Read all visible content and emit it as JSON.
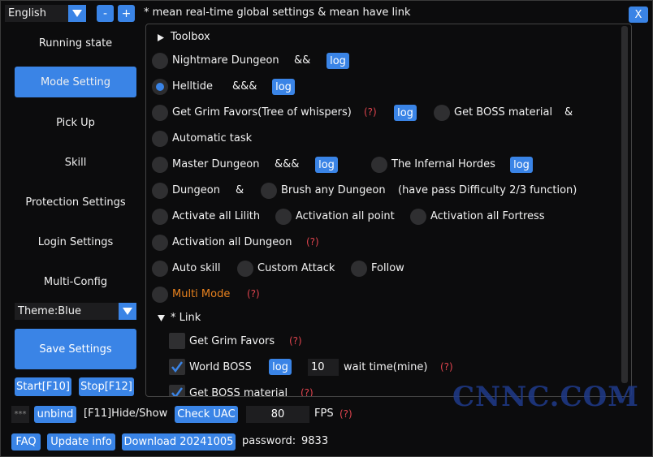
{
  "topbar": {
    "language": "English",
    "minus": "-",
    "plus": "+",
    "legend": "* mean real-time global settings   & mean have link",
    "close": "X"
  },
  "sidebar": {
    "items": [
      {
        "label": "Running state"
      },
      {
        "label": "Mode Setting"
      },
      {
        "label": "Pick Up"
      },
      {
        "label": "Skill"
      },
      {
        "label": "Protection Settings"
      },
      {
        "label": "Login Settings"
      },
      {
        "label": "Multi-Config"
      }
    ],
    "theme": "Theme:Blue",
    "save": "Save Settings",
    "start": "Start[F10]",
    "stop": "Stop[F12]"
  },
  "panel": {
    "toolbox": "Toolbox",
    "log": "log",
    "q": "(?)",
    "rows": {
      "nightmare": "Nightmare Dungeon",
      "nightmare_amp": "&&",
      "helltide": "Helltide",
      "helltide_amp": "&&&",
      "grim": "Get Grim Favors(Tree of whispers)",
      "boss_mat": "Get BOSS material",
      "boss_amp": "&",
      "auto_task": "Automatic task",
      "master": "Master Dungeon",
      "master_amp": "&&&",
      "hordes": "The Infernal Hordes",
      "dungeon": "Dungeon",
      "dungeon_amp": "&",
      "brush": "Brush any Dungeon",
      "brush_note": "(have pass Difficulty 2/3 function)",
      "lilith": "Activate all Lilith",
      "point": "Activation all point",
      "fortress": "Activation all Fortress",
      "act_dungeon": "Activation all Dungeon",
      "auto_skill": "Auto skill",
      "custom_attack": "Custom Attack",
      "follow": "Follow",
      "multi": "Multi Mode"
    },
    "link": {
      "header": "* Link",
      "grim": "Get Grim Favors",
      "world_boss": "World BOSS",
      "wait_value": "10",
      "wait_label": "wait time(mine)",
      "boss_mat": "Get BOSS material"
    }
  },
  "bottom": {
    "stars": "***",
    "unbind": "unbind",
    "hide": "[F11]Hide/Show",
    "uac": "Check UAC",
    "fps_value": "80",
    "fps": "FPS",
    "faq": "FAQ",
    "update": "Update info",
    "download": "Download 20241005",
    "password_label": "password:",
    "password": "9833"
  },
  "watermark": "CNNC.COM",
  "colors": {
    "accent": "#3a84e6",
    "warn": "#e0444e",
    "multi": "#e8821e"
  }
}
